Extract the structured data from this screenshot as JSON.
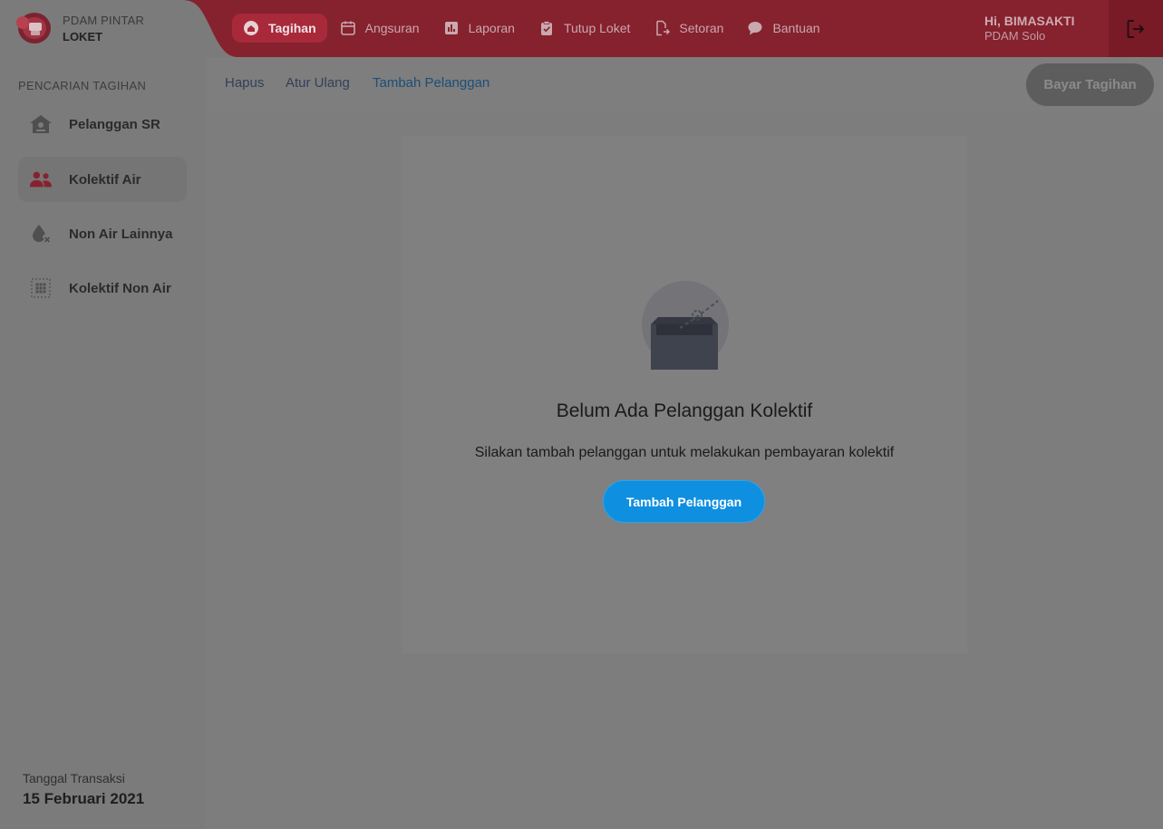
{
  "brand": {
    "line1": "PDAM PINTAR",
    "line2": "LOKET",
    "logo_icon": "pdam-logo-icon"
  },
  "nav": [
    {
      "label": "Tagihan",
      "icon": "home-icon",
      "active": true
    },
    {
      "label": "Angsuran",
      "icon": "calendar-icon",
      "active": false
    },
    {
      "label": "Laporan",
      "icon": "report-chart-icon",
      "active": false
    },
    {
      "label": "Tutup Loket",
      "icon": "clipboard-check-icon",
      "active": false
    },
    {
      "label": "Setoran",
      "icon": "document-export-icon",
      "active": false
    },
    {
      "label": "Bantuan",
      "icon": "chat-bubble-icon",
      "active": false
    }
  ],
  "user": {
    "greeting": "Hi, BIMASAKTI",
    "org": "PDAM Solo"
  },
  "sidebar": {
    "heading": "PENCARIAN TAGIHAN",
    "items": [
      {
        "label": "Pelanggan SR",
        "icon": "house-icon",
        "active": false
      },
      {
        "label": "Kolektif Air",
        "icon": "users-icon",
        "active": true
      },
      {
        "label": "Non Air Lainnya",
        "icon": "water-drop-x-icon",
        "active": false
      },
      {
        "label": "Kolektif Non Air",
        "icon": "grid-dots-icon",
        "active": false
      }
    ],
    "transaction_label": "Tanggal Transaksi",
    "transaction_date": "15 Februari 2021"
  },
  "toolbar": {
    "clear": "Hapus",
    "reset": "Atur Ulang",
    "add_customer": "Tambah Pelanggan",
    "pay": "Bayar Tagihan"
  },
  "empty_state": {
    "title": "Belum Ada Pelanggan Kolektif",
    "description": "Silakan tambah pelanggan untuk melakukan pembayaran kolektif",
    "button": "Tambah Pelanggan",
    "icon": "empty-inbox-icon"
  },
  "colors": {
    "header": "#86212e",
    "accent_red": "#a8293a",
    "primary_blue": "#0f8fe0",
    "overlay_gray": "#7d7d7d"
  }
}
